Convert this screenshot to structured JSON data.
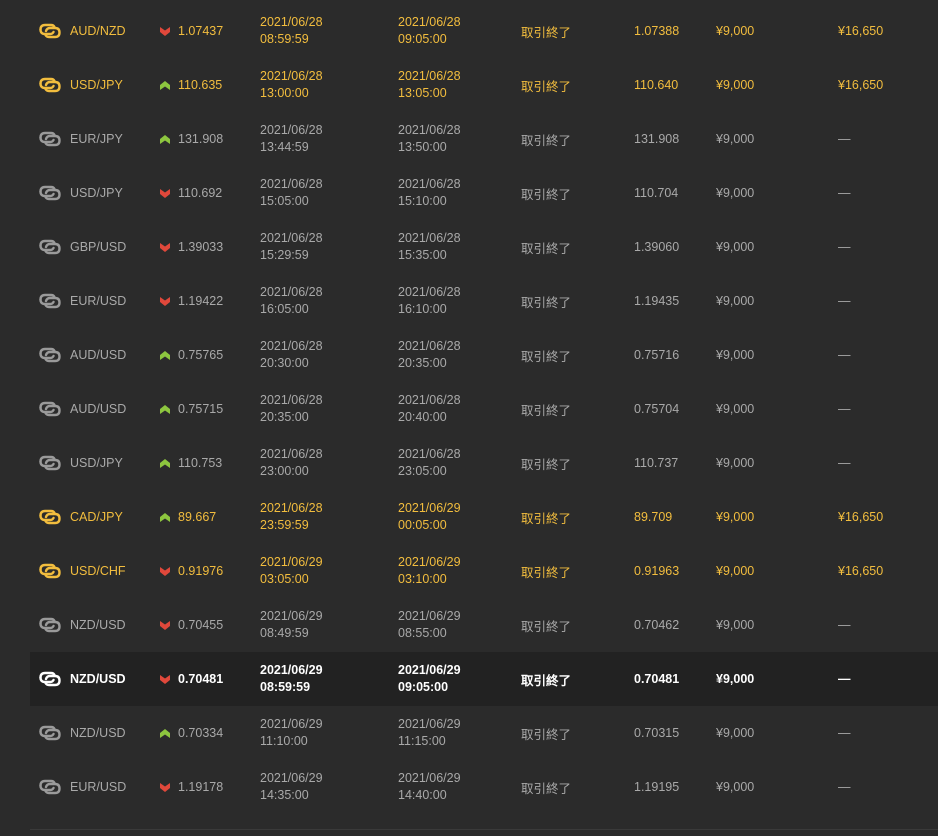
{
  "colors": {
    "win": "#f2bd3e",
    "loss": "#a9a9a9",
    "active": "#ffffff",
    "up": "#8dc63f",
    "down": "#e0483b"
  },
  "trades": [
    {
      "pair": "AUD/NZD",
      "dir": "down",
      "rate": "1.07437",
      "entry_date": "2021/06/28",
      "entry_time": "08:59:59",
      "exit_date": "2021/06/28",
      "exit_time": "09:05:00",
      "status": "取引終了",
      "close": "1.07388",
      "amount": "¥9,000",
      "payout": "¥16,650",
      "state": "win"
    },
    {
      "pair": "USD/JPY",
      "dir": "up",
      "rate": "110.635",
      "entry_date": "2021/06/28",
      "entry_time": "13:00:00",
      "exit_date": "2021/06/28",
      "exit_time": "13:05:00",
      "status": "取引終了",
      "close": "110.640",
      "amount": "¥9,000",
      "payout": "¥16,650",
      "state": "win"
    },
    {
      "pair": "EUR/JPY",
      "dir": "up",
      "rate": "131.908",
      "entry_date": "2021/06/28",
      "entry_time": "13:44:59",
      "exit_date": "2021/06/28",
      "exit_time": "13:50:00",
      "status": "取引終了",
      "close": "131.908",
      "amount": "¥9,000",
      "payout": "—",
      "state": "loss"
    },
    {
      "pair": "USD/JPY",
      "dir": "down",
      "rate": "110.692",
      "entry_date": "2021/06/28",
      "entry_time": "15:05:00",
      "exit_date": "2021/06/28",
      "exit_time": "15:10:00",
      "status": "取引終了",
      "close": "110.704",
      "amount": "¥9,000",
      "payout": "—",
      "state": "loss"
    },
    {
      "pair": "GBP/USD",
      "dir": "down",
      "rate": "1.39033",
      "entry_date": "2021/06/28",
      "entry_time": "15:29:59",
      "exit_date": "2021/06/28",
      "exit_time": "15:35:00",
      "status": "取引終了",
      "close": "1.39060",
      "amount": "¥9,000",
      "payout": "—",
      "state": "loss"
    },
    {
      "pair": "EUR/USD",
      "dir": "down",
      "rate": "1.19422",
      "entry_date": "2021/06/28",
      "entry_time": "16:05:00",
      "exit_date": "2021/06/28",
      "exit_time": "16:10:00",
      "status": "取引終了",
      "close": "1.19435",
      "amount": "¥9,000",
      "payout": "—",
      "state": "loss"
    },
    {
      "pair": "AUD/USD",
      "dir": "up",
      "rate": "0.75765",
      "entry_date": "2021/06/28",
      "entry_time": "20:30:00",
      "exit_date": "2021/06/28",
      "exit_time": "20:35:00",
      "status": "取引終了",
      "close": "0.75716",
      "amount": "¥9,000",
      "payout": "—",
      "state": "loss"
    },
    {
      "pair": "AUD/USD",
      "dir": "up",
      "rate": "0.75715",
      "entry_date": "2021/06/28",
      "entry_time": "20:35:00",
      "exit_date": "2021/06/28",
      "exit_time": "20:40:00",
      "status": "取引終了",
      "close": "0.75704",
      "amount": "¥9,000",
      "payout": "—",
      "state": "loss"
    },
    {
      "pair": "USD/JPY",
      "dir": "up",
      "rate": "110.753",
      "entry_date": "2021/06/28",
      "entry_time": "23:00:00",
      "exit_date": "2021/06/28",
      "exit_time": "23:05:00",
      "status": "取引終了",
      "close": "110.737",
      "amount": "¥9,000",
      "payout": "—",
      "state": "loss"
    },
    {
      "pair": "CAD/JPY",
      "dir": "up",
      "rate": "89.667",
      "entry_date": "2021/06/28",
      "entry_time": "23:59:59",
      "exit_date": "2021/06/29",
      "exit_time": "00:05:00",
      "status": "取引終了",
      "close": "89.709",
      "amount": "¥9,000",
      "payout": "¥16,650",
      "state": "win"
    },
    {
      "pair": "USD/CHF",
      "dir": "down",
      "rate": "0.91976",
      "entry_date": "2021/06/29",
      "entry_time": "03:05:00",
      "exit_date": "2021/06/29",
      "exit_time": "03:10:00",
      "status": "取引終了",
      "close": "0.91963",
      "amount": "¥9,000",
      "payout": "¥16,650",
      "state": "win"
    },
    {
      "pair": "NZD/USD",
      "dir": "down",
      "rate": "0.70455",
      "entry_date": "2021/06/29",
      "entry_time": "08:49:59",
      "exit_date": "2021/06/29",
      "exit_time": "08:55:00",
      "status": "取引終了",
      "close": "0.70462",
      "amount": "¥9,000",
      "payout": "—",
      "state": "loss"
    },
    {
      "pair": "NZD/USD",
      "dir": "down",
      "rate": "0.70481",
      "entry_date": "2021/06/29",
      "entry_time": "08:59:59",
      "exit_date": "2021/06/29",
      "exit_time": "09:05:00",
      "status": "取引終了",
      "close": "0.70481",
      "amount": "¥9,000",
      "payout": "—",
      "state": "active"
    },
    {
      "pair": "NZD/USD",
      "dir": "up",
      "rate": "0.70334",
      "entry_date": "2021/06/29",
      "entry_time": "11:10:00",
      "exit_date": "2021/06/29",
      "exit_time": "11:15:00",
      "status": "取引終了",
      "close": "0.70315",
      "amount": "¥9,000",
      "payout": "—",
      "state": "loss"
    },
    {
      "pair": "EUR/USD",
      "dir": "down",
      "rate": "1.19178",
      "entry_date": "2021/06/29",
      "entry_time": "14:35:00",
      "exit_date": "2021/06/29",
      "exit_time": "14:40:00",
      "status": "取引終了",
      "close": "1.19195",
      "amount": "¥9,000",
      "payout": "—",
      "state": "loss"
    }
  ]
}
